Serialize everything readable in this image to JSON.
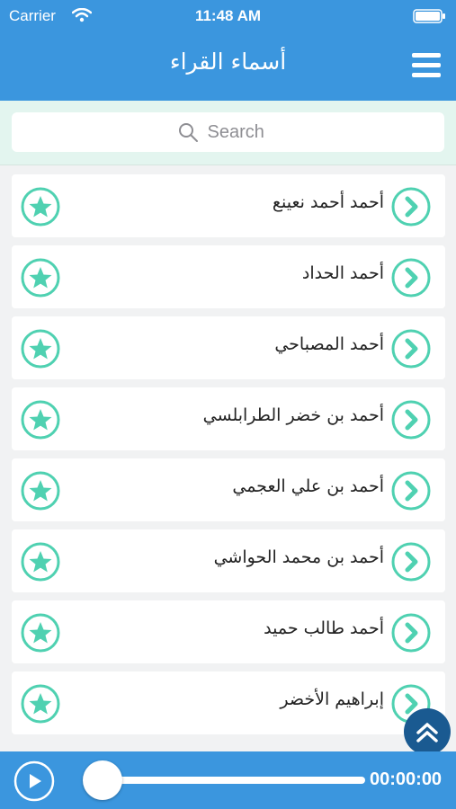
{
  "status_bar": {
    "carrier": "Carrier",
    "time": "11:48 AM"
  },
  "nav": {
    "title": "أسماء القراء"
  },
  "search": {
    "placeholder": "Search"
  },
  "reciters": [
    {
      "name": "أحمد أحمد نعينع"
    },
    {
      "name": "أحمد الحداد"
    },
    {
      "name": "أحمد المصباحي"
    },
    {
      "name": "أحمد بن خضر الطرابلسي"
    },
    {
      "name": "أحمد بن علي العجمي"
    },
    {
      "name": "أحمد بن محمد الحواشي"
    },
    {
      "name": "أحمد طالب حميد"
    },
    {
      "name": "إبراهيم الأخضر"
    }
  ],
  "player": {
    "elapsed": "00:00:00",
    "progress": 0
  },
  "colors": {
    "primary": "#3b96de",
    "accent": "#4fd1b1",
    "dark_accent": "#1a5a91"
  }
}
